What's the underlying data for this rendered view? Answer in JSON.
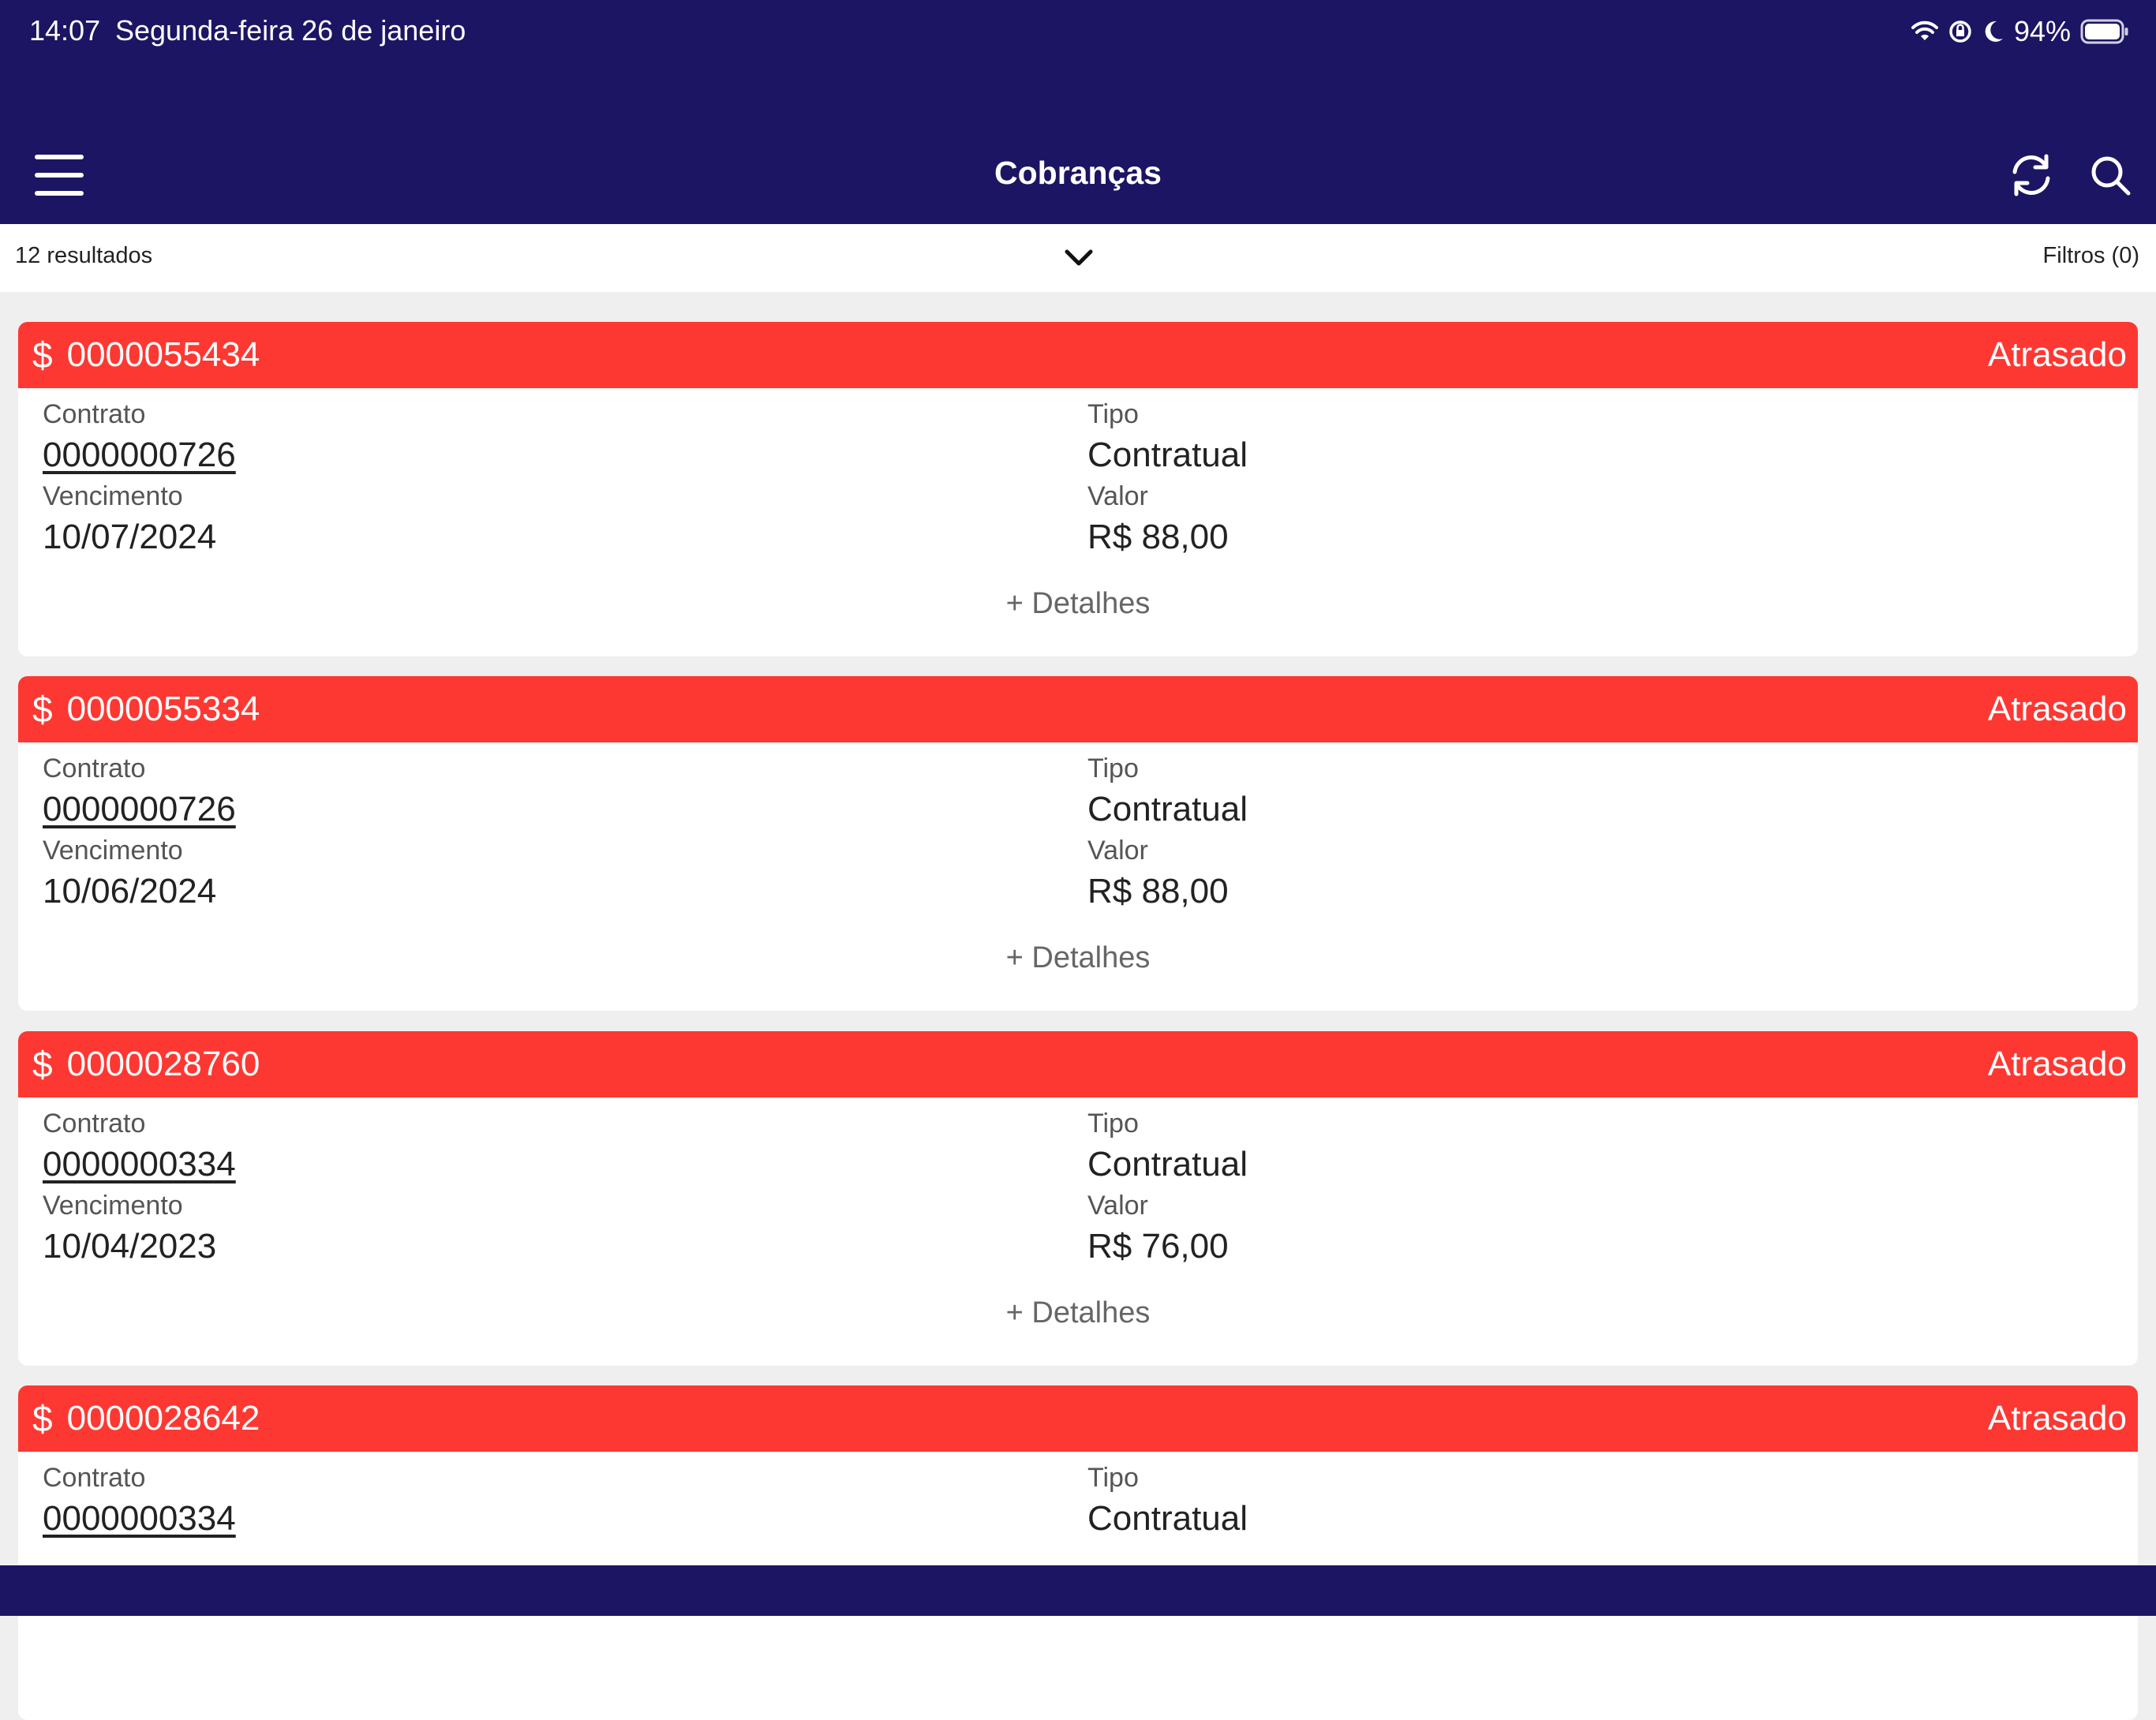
{
  "status_bar": {
    "time": "14:07",
    "date": "Segunda-feira 26 de janeiro",
    "battery": "94%"
  },
  "nav": {
    "title": "Cobranças",
    "menu_icon": "hamburger-menu-icon",
    "refresh_icon": "refresh-icon",
    "search_icon": "search-icon"
  },
  "results": {
    "count": "12 resultados",
    "filters": "Filtros (0)",
    "toggle_icon": "chevron-down-icon"
  },
  "colors": {
    "header": "#1c1563",
    "overdue": "#fd3833"
  },
  "labels": {
    "contract": "Contrato",
    "type": "Tipo",
    "due": "Vencimento",
    "value": "Valor",
    "details": "+ Detalhes",
    "currency_symbol": "$"
  },
  "cards": [
    {
      "id": "0000055434",
      "status": "Atrasado",
      "contract": "0000000726",
      "type": "Contratual",
      "due": "10/07/2024",
      "value": "R$ 88,00"
    },
    {
      "id": "0000055334",
      "status": "Atrasado",
      "contract": "0000000726",
      "type": "Contratual",
      "due": "10/06/2024",
      "value": "R$ 88,00"
    },
    {
      "id": "0000028760",
      "status": "Atrasado",
      "contract": "0000000334",
      "type": "Contratual",
      "due": "10/04/2023",
      "value": "R$ 76,00"
    },
    {
      "id": "0000028642",
      "status": "Atrasado",
      "contract": "0000000334",
      "type": "Contratual",
      "due": "",
      "value": ""
    }
  ]
}
